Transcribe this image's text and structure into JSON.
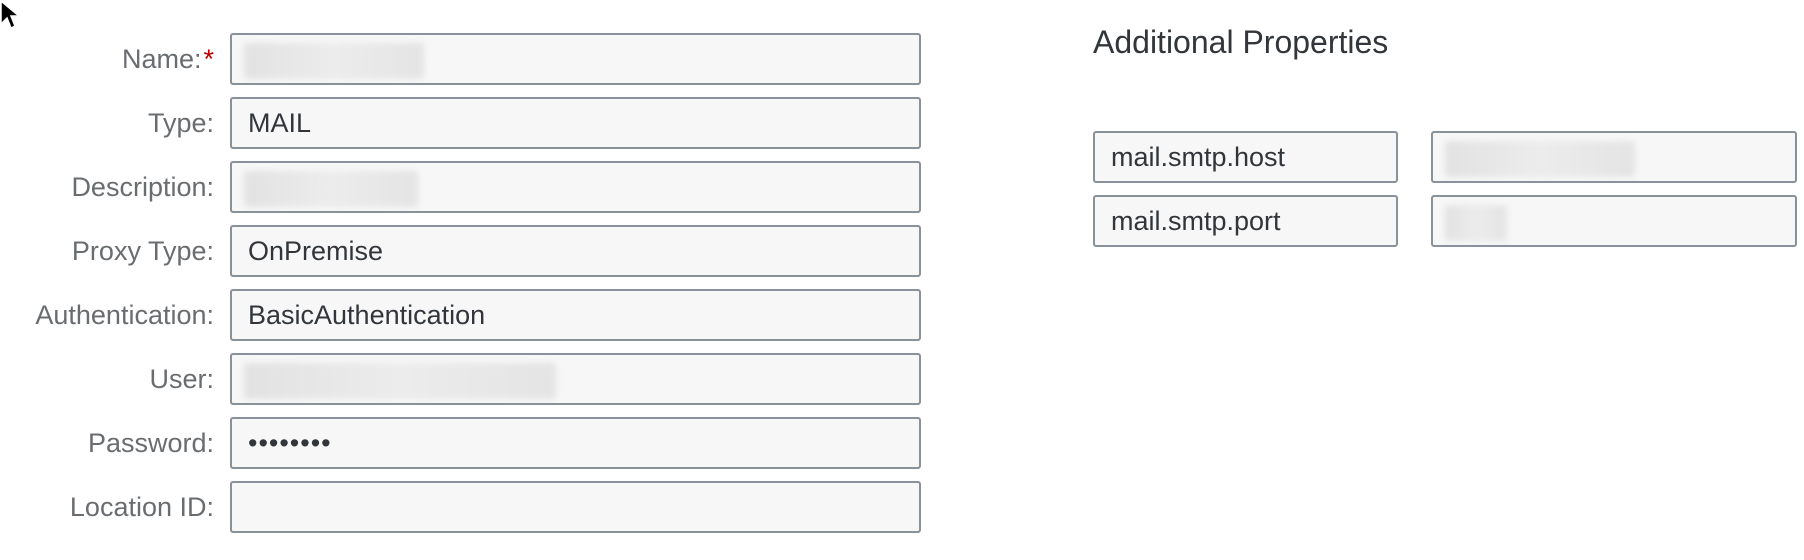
{
  "form": {
    "fields": [
      {
        "label": "Name:",
        "required_mark": "*",
        "value": ""
      },
      {
        "label": "Type:",
        "value": "MAIL"
      },
      {
        "label": "Description:",
        "value": ""
      },
      {
        "label": "Proxy Type:",
        "value": "OnPremise"
      },
      {
        "label": "Authentication:",
        "value": "BasicAuthentication"
      },
      {
        "label": "User:",
        "value": ""
      },
      {
        "label": "Password:",
        "value": "••••••••"
      },
      {
        "label": "Location ID:",
        "value": ""
      }
    ]
  },
  "additional_properties": {
    "title": "Additional Properties",
    "items": [
      {
        "key": "mail.smtp.host",
        "value": ""
      },
      {
        "key": "mail.smtp.port",
        "value": ""
      }
    ]
  },
  "colors": {
    "required": "#bb0000",
    "field_border": "#89919a",
    "field_background": "#f7f7f7",
    "label_text": "#6a6d70",
    "value_text": "#32363a"
  },
  "icons": {
    "cursor": "mouse-pointer-icon"
  }
}
